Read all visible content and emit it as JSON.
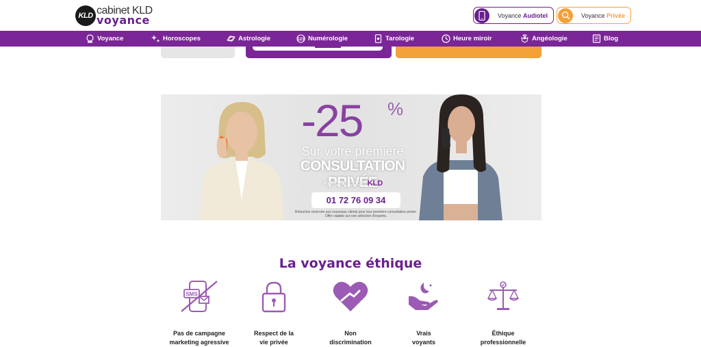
{
  "logo": {
    "mark": "KLD",
    "line1": "cabinet KLD",
    "line2": "voyance"
  },
  "header_buttons": {
    "audiotel": {
      "prefix": "Voyance ",
      "highlight": "Audiotel"
    },
    "privee": {
      "prefix": "Voyance ",
      "highlight": "Privée"
    }
  },
  "nav": [
    {
      "label": "Voyance",
      "icon": "crystal-ball-icon"
    },
    {
      "label": "Horoscopes",
      "icon": "stars-icon"
    },
    {
      "label": "Astrologie",
      "icon": "planet-icon"
    },
    {
      "label": "Numérologie",
      "icon": "numbers-icon"
    },
    {
      "label": "Tarologie",
      "icon": "tarot-card-icon"
    },
    {
      "label": "Heure miroir",
      "icon": "clock-icon"
    },
    {
      "label": "Angéologie",
      "icon": "angel-icon"
    },
    {
      "label": "Blog",
      "icon": "blog-icon"
    }
  ],
  "banner": {
    "discount": "-25",
    "percent": "%",
    "line1": "Sur votre première",
    "line2": "CONSULTATION PRIVÉE",
    "code_prefix": "Avec le code ",
    "code": "KLD",
    "phone": "01 72 76 09 34",
    "fine1": "Réduction réservée aux nouveaux clients pour leur première consultation privée.",
    "fine2": "Offre valable sur une sélection d'experts."
  },
  "ethics": {
    "title": "La voyance éthique",
    "items": [
      {
        "line1": "Pas de campagne",
        "line2": "marketing agressive",
        "icon": "no-sms-icon"
      },
      {
        "line1": "Respect de la",
        "line2": "vie privée",
        "icon": "padlock-icon"
      },
      {
        "line1": "Non",
        "line2": "discrimination",
        "icon": "heart-hand-icon"
      },
      {
        "line1": "Vrais",
        "line2": "voyants",
        "icon": "moon-hand-icon"
      },
      {
        "line1": "Éthique",
        "line2": "professionnelle",
        "icon": "scales-icon"
      }
    ]
  },
  "colors": {
    "purple": "#7a2696",
    "orange": "#f4a13a"
  }
}
